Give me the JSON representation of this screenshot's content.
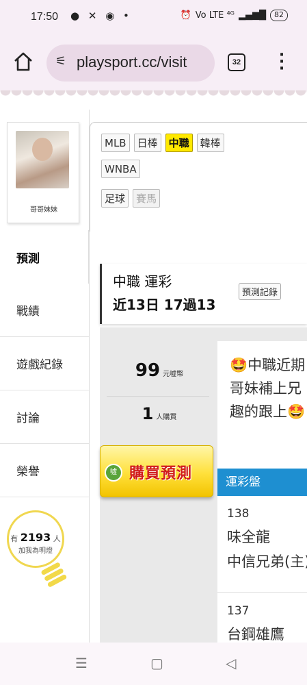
{
  "status_bar": {
    "time": "17:50",
    "left_icons": "● ✕ ◉ •",
    "signal": "Vo LTE ⁴ᴳ",
    "battery": "82"
  },
  "browser": {
    "url": "playsport.cc/visit",
    "tab_count": "32"
  },
  "sidebar": {
    "username": "哥哥妹妹",
    "tabs": [
      {
        "label": "預測",
        "active": true
      },
      {
        "label": "戰績",
        "active": false
      },
      {
        "label": "遊戲紀錄",
        "active": false
      },
      {
        "label": "討論",
        "active": false
      },
      {
        "label": "榮譽",
        "active": false
      }
    ],
    "bulb": {
      "prefix": "有",
      "count": "2193",
      "suffix": "人",
      "caption": "加我為明燈"
    }
  },
  "categories": {
    "row1": [
      "MLB",
      "日棒",
      "中職",
      "韓棒"
    ],
    "row2": [
      "WNBA"
    ],
    "row3": [
      "足球",
      "賽馬"
    ],
    "active": "中職",
    "disabled": [
      "賽馬"
    ]
  },
  "prediction": {
    "title": "中職 運彩",
    "record": "近13日 17過13",
    "record_button": "預測記錄",
    "price": "99",
    "price_unit": "元噓幣",
    "buyers": "1",
    "buyers_unit": "人購買",
    "buy_button": "購買預測",
    "buy_icon": "噓",
    "description_lines": [
      "🤩中職近期",
      "哥妹補上兄",
      "趣的跟上🤩"
    ],
    "odds_header": "運彩盤",
    "games": [
      {
        "no": "138",
        "teams": [
          "味全龍",
          "中信兄弟(主)"
        ]
      },
      {
        "no": "137",
        "teams": [
          "台鋼雄鷹"
        ]
      }
    ]
  },
  "navbar": {
    "recent": "☰",
    "home": "▢",
    "back": "◁"
  }
}
